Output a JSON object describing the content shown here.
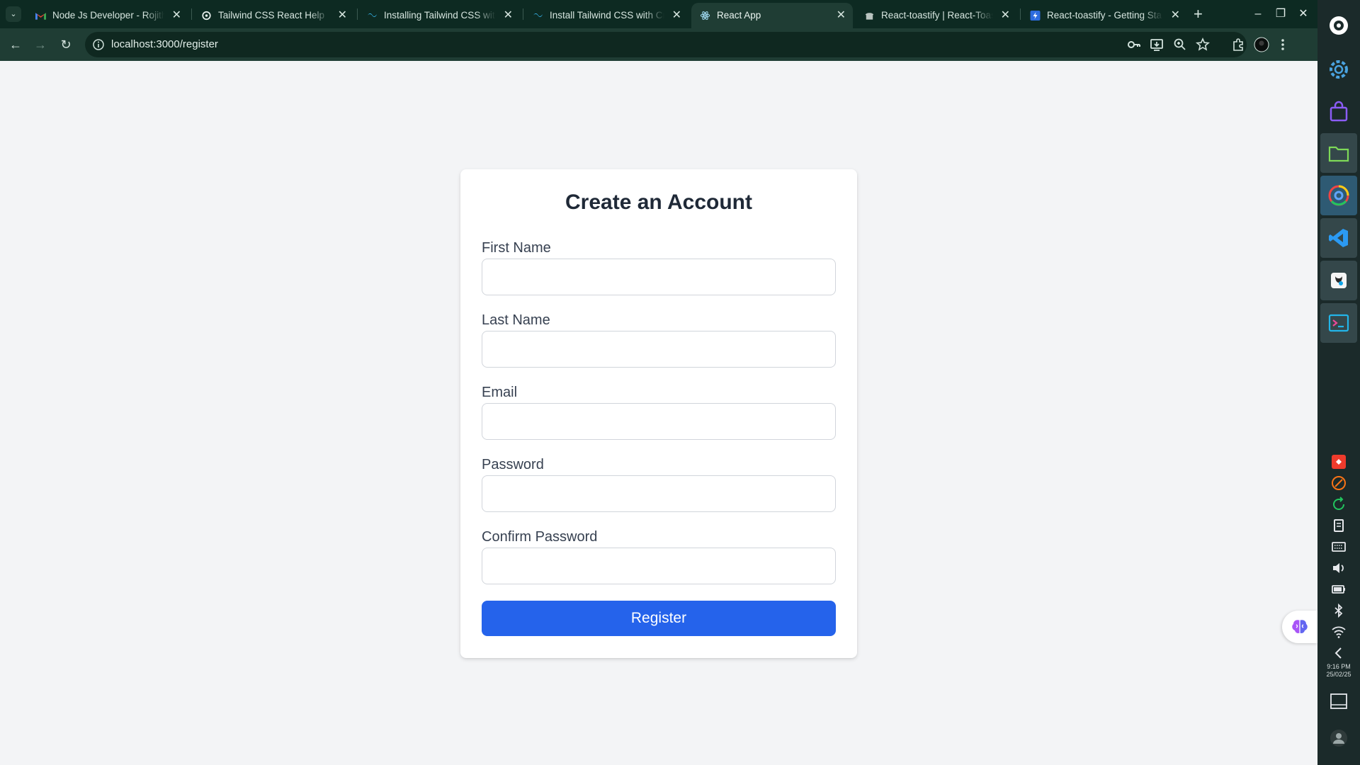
{
  "browser": {
    "tabs": [
      {
        "title": "Node Js Developer - Rojith",
        "active": false,
        "favicon": "gmail-icon"
      },
      {
        "title": "Tailwind CSS React Help",
        "active": false,
        "favicon": "openai-icon"
      },
      {
        "title": "Installing Tailwind CSS with",
        "active": false,
        "favicon": "tailwind-icon"
      },
      {
        "title": "Install Tailwind CSS with Cr",
        "active": false,
        "favicon": "tailwind-icon"
      },
      {
        "title": "React App",
        "active": true,
        "favicon": "react-icon"
      },
      {
        "title": "React-toastify | React-Toas",
        "active": false,
        "favicon": "toastify-icon"
      },
      {
        "title": "React-toastify - Getting Sta",
        "active": false,
        "favicon": "bolt-icon"
      }
    ],
    "url": "localhost:3000/register",
    "colors": {
      "frame": "#0d2a22",
      "toolbar": "#1f3d34",
      "page_bg": "#f3f4f6"
    }
  },
  "form": {
    "title": "Create an Account",
    "fields": [
      {
        "label": "First Name",
        "value": ""
      },
      {
        "label": "Last Name",
        "value": ""
      },
      {
        "label": "Email",
        "value": ""
      },
      {
        "label": "Password",
        "value": ""
      },
      {
        "label": "Confirm Password",
        "value": ""
      }
    ],
    "submit_label": "Register",
    "accent": "#2563eb"
  },
  "taskbar": {
    "apps": [
      "settings-icon",
      "store-icon",
      "files-icon",
      "chrome-icon",
      "vscode-icon",
      "app-icon",
      "terminal-icon"
    ],
    "tray": [
      "anydesk-icon",
      "network-icon",
      "update-icon",
      "clipboard-icon",
      "keyboard-icon",
      "volume-icon",
      "battery-icon",
      "bluetooth-icon",
      "wifi-icon",
      "chevron-left-icon"
    ],
    "time": "9:16 PM",
    "date": "25/02/25"
  }
}
